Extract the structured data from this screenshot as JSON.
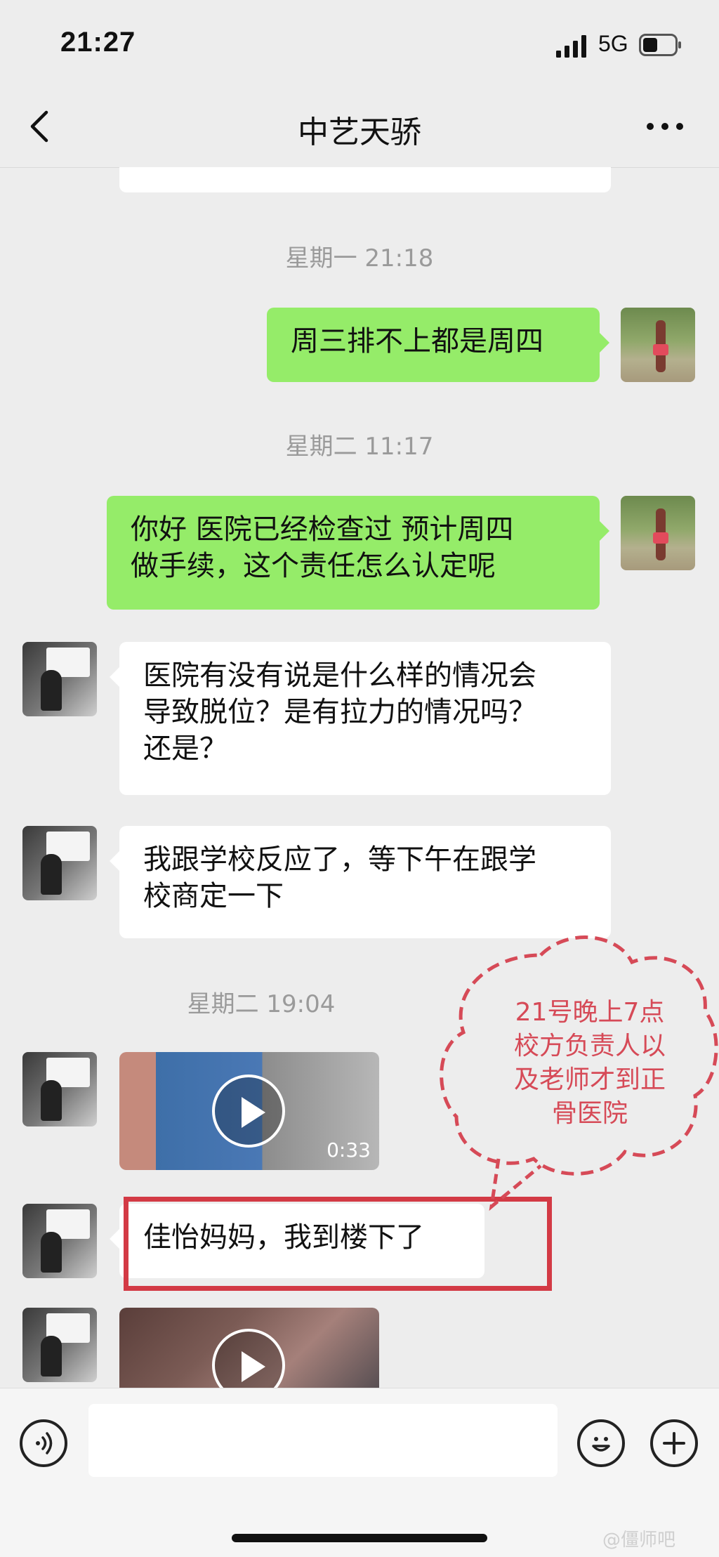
{
  "status_bar": {
    "time": "21:27",
    "network": "5G"
  },
  "nav": {
    "title": "中艺天骄"
  },
  "messages": [
    {
      "type": "timestamp",
      "text": "星期一 21:18"
    },
    {
      "type": "text",
      "side": "right",
      "sender": "self",
      "text": "周三排不上都是周四"
    },
    {
      "type": "timestamp",
      "text": "星期二 11:17"
    },
    {
      "type": "text",
      "side": "right",
      "sender": "self",
      "lines": [
        "你好  医院已经检查过  预计周四",
        "做手续，这个责任怎么认定呢"
      ]
    },
    {
      "type": "text",
      "side": "left",
      "sender": "teacher",
      "lines": [
        "医院有没有说是什么样的情况会",
        "导致脱位？是有拉力的情况吗？",
        "还是？"
      ]
    },
    {
      "type": "text",
      "side": "left",
      "sender": "teacher",
      "lines": [
        "我跟学校反应了，等下午在跟学",
        "校商定一下"
      ]
    },
    {
      "type": "timestamp",
      "text": "星期二 19:04"
    },
    {
      "type": "video",
      "side": "left",
      "sender": "teacher",
      "duration": "0:33"
    },
    {
      "type": "text",
      "side": "left",
      "sender": "teacher",
      "text": "佳怡妈妈，我到楼下了"
    },
    {
      "type": "video",
      "side": "left",
      "sender": "teacher",
      "duration": ""
    }
  ],
  "annotation": {
    "callout_lines": [
      "21号晚上7点",
      "校方负责人以",
      "及老师才到正",
      "骨医院"
    ],
    "frame_color": "#d33a45",
    "text_color": "#d64a57"
  },
  "input_bar": {
    "placeholder": ""
  },
  "watermark": "@僵师吧",
  "colors": {
    "background": "#ededed",
    "self_bubble": "#95ec69",
    "other_bubble": "#ffffff",
    "timestamp": "#9a9a9a"
  }
}
